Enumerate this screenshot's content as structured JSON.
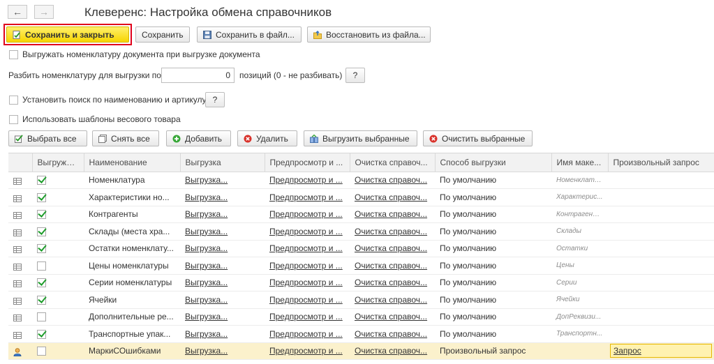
{
  "window": {
    "title": "Клеверенс: Настройка обмена справочников"
  },
  "nav": {
    "back": "←",
    "forward": "→"
  },
  "toolbar": {
    "save_close": "Сохранить и закрыть",
    "save": "Сохранить",
    "save_file": "Сохранить в файл...",
    "restore": "Восстановить из файла..."
  },
  "options": {
    "export_nomenclature": "Выгружать номенклатуру документа при выгрузке документа",
    "split_label": "Разбить номенклатуру для выгрузки по:",
    "split_value": "0",
    "split_hint": "позиций (0 - не разбивать)",
    "search_setting": "Установить поиск по наименованию и артикулу",
    "weight_templates": "Использовать шаблоны весового товара",
    "help": "?"
  },
  "actions": {
    "select_all": "Выбрать все",
    "unselect_all": "Снять все",
    "add": "Добавить",
    "delete": "Удалить",
    "export_selected": "Выгрузить выбранные",
    "clear_selected": "Очистить выбранные"
  },
  "colors": {
    "accent": "#f7d500",
    "highlight_frame": "#e0001b",
    "check": "#1f9d2c",
    "selected_row": "#fbf1cc"
  },
  "table": {
    "headers": [
      "",
      "Выгружать",
      "Наименование",
      "Выгрузка",
      "Предпросмотр и ...",
      "Очистка справоч...",
      "Способ выгрузки",
      "Имя маке...",
      "Произвольный запрос"
    ],
    "rows": [
      {
        "checked": true,
        "name": "Номенклатура",
        "export": "Выгрузка...",
        "preview": "Предпросмотр и ...",
        "clear": "Очистка справоч...",
        "method": "По умолчанию",
        "layout": "Номенклатура",
        "query": ""
      },
      {
        "checked": true,
        "name": "Характеристики но...",
        "export": "Выгрузка...",
        "preview": "Предпросмотр и ...",
        "clear": "Очистка справоч...",
        "method": "По умолчанию",
        "layout": "Характерис...",
        "query": ""
      },
      {
        "checked": true,
        "name": "Контрагенты",
        "export": "Выгрузка...",
        "preview": "Предпросмотр и ...",
        "clear": "Очистка справоч...",
        "method": "По умолчанию",
        "layout": "Контрагенты",
        "query": ""
      },
      {
        "checked": true,
        "name": "Склады (места хра...",
        "export": "Выгрузка...",
        "preview": "Предпросмотр и ...",
        "clear": "Очистка справоч...",
        "method": "По умолчанию",
        "layout": "Склады",
        "query": ""
      },
      {
        "checked": true,
        "name": "Остатки номенклату...",
        "export": "Выгрузка...",
        "preview": "Предпросмотр и ...",
        "clear": "Очистка справоч...",
        "method": "По умолчанию",
        "layout": "Остатки",
        "query": ""
      },
      {
        "checked": false,
        "name": "Цены номенклатуры",
        "export": "Выгрузка...",
        "preview": "Предпросмотр и ...",
        "clear": "Очистка справоч...",
        "method": "По умолчанию",
        "layout": "Цены",
        "query": ""
      },
      {
        "checked": true,
        "name": "Серии номенклатуры",
        "export": "Выгрузка...",
        "preview": "Предпросмотр и ...",
        "clear": "Очистка справоч...",
        "method": "По умолчанию",
        "layout": "Серии",
        "query": ""
      },
      {
        "checked": true,
        "name": "Ячейки",
        "export": "Выгрузка...",
        "preview": "Предпросмотр и ...",
        "clear": "Очистка справоч...",
        "method": "По умолчанию",
        "layout": "Ячейки",
        "query": ""
      },
      {
        "checked": false,
        "name": "Дополнительные ре...",
        "export": "Выгрузка...",
        "preview": "Предпросмотр и ...",
        "clear": "Очистка справоч...",
        "method": "По умолчанию",
        "layout": "ДопРеквизи...",
        "query": ""
      },
      {
        "checked": true,
        "name": "Транспортные упак...",
        "export": "Выгрузка...",
        "preview": "Предпросмотр и ...",
        "clear": "Очистка справоч...",
        "method": "По умолчанию",
        "layout": "Транспортн...",
        "query": ""
      },
      {
        "checked": false,
        "name": "МаркиСОшибками",
        "export": "Выгрузка...",
        "preview": "Предпросмотр и ...",
        "clear": "Очистка справоч...",
        "method": "Произвольный запрос",
        "layout": "",
        "query": "Запрос",
        "selected": true
      }
    ]
  }
}
